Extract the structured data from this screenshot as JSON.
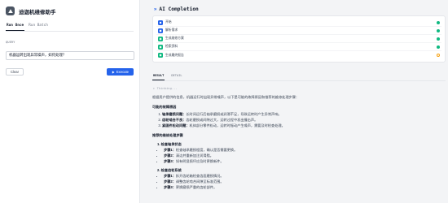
{
  "app": {
    "title": "迪迦机维修助手"
  },
  "modes": [
    {
      "label": "Run Once",
      "active": true
    },
    {
      "label": "Run Batch",
      "active": false
    }
  ],
  "query": {
    "label": "QUERY",
    "value": "机器运转出现异常噪声，如何处理？"
  },
  "buttons": {
    "clear": "Clear",
    "execute": "Execute"
  },
  "completion": {
    "title": "AI Completion"
  },
  "steps": [
    {
      "label": "开始",
      "color": "#2563eb",
      "status": "done"
    },
    {
      "label": "解析需求",
      "color": "#2563eb",
      "status": "done"
    },
    {
      "label": "生成维修方案",
      "color": "#10b981",
      "status": "done"
    },
    {
      "label": "检索资料",
      "color": "#10b981",
      "status": "done"
    },
    {
      "label": "生成最终报告",
      "color": "#10b981",
      "status": "pending"
    }
  ],
  "result_tabs": [
    {
      "label": "RESULT",
      "active": true
    },
    {
      "label": "DETAIL",
      "active": false
    }
  ],
  "result": {
    "thinking": "▸ Thinking...",
    "intro": "根据用户提供的信息，机器运行时出现异常噪声，以下是可能的故障原因和推荐的维修处理步骤：",
    "causes_heading": "可能的故障原因",
    "causes": [
      {
        "title": "轴承磨损问题：",
        "text": "长时间运行后轴承磨损或润滑不足，导致运转时产生异常声响。"
      },
      {
        "title": "齿轮啮合不良：",
        "text": "齿轮磨损或间隙过大，运转过程中发出撞击声。"
      },
      {
        "title": "紧固件松动问题：",
        "text": "机体部分零件松动，运转时振动产生噪声，需要及时检查处理。"
      }
    ],
    "plan_heading": "推荐的维修处理步骤",
    "sections": [
      {
        "title": "1. 检查轴承状态",
        "items": [
          {
            "step": "步骤1：",
            "text": "检查轴承磨损程度，确认是否需要更换。"
          },
          {
            "step": "步骤2：",
            "text": "清洁并重新加注润滑脂。"
          },
          {
            "step": "步骤3：",
            "text": "如有明显损坏应及时更换新件。"
          }
        ]
      },
      {
        "title": "2. 检查齿轮系统",
        "items": [
          {
            "step": "步骤1：",
            "text": "拆开齿轮箱检查齿面磨损情况。"
          },
          {
            "step": "步骤2：",
            "text": "调整齿轮啮合间隙至标准范围。"
          },
          {
            "step": "步骤3：",
            "text": "更换磨损严重的齿轮部件。"
          }
        ]
      }
    ]
  },
  "colors": {
    "accent": "#2563eb",
    "success": "#10b981",
    "pending": "#f59e0b"
  }
}
